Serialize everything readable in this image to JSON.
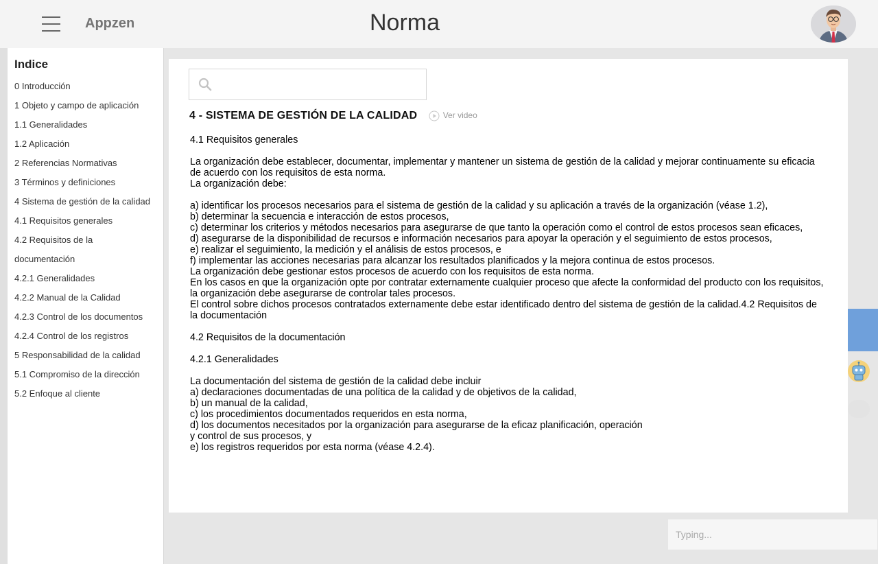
{
  "header": {
    "brand": "Appzen",
    "title": "Norma"
  },
  "sidebar": {
    "heading": "Indice",
    "items": [
      "0 Introducción",
      "1 Objeto y campo de aplicación",
      "1.1 Generalidades",
      "1.2 Aplicación",
      "2 Referencias Normativas",
      "3 Términos y definiciones",
      "4 Sistema de gestión de la calidad",
      "4.1 Requisitos generales",
      "4.2 Requisitos de la",
      "documentación",
      "4.2.1 Generalidades",
      "4.2.2 Manual de la Calidad",
      "4.2.3 Control de los documentos",
      "4.2.4 Control de los registros",
      "5 Responsabilidad de la calidad",
      "5.1 Compromiso de la dirección",
      "5.2 Enfoque al cliente"
    ]
  },
  "search": {
    "placeholder": ""
  },
  "section": {
    "title": "4 - SISTEMA DE GESTIÓN DE LA CALIDAD",
    "video_label": "Ver video"
  },
  "document": {
    "lines": [
      "4.1 Requisitos generales",
      "",
      "La organización debe establecer, documentar, implementar y mantener un sistema de gestión de la calidad y mejorar continuamente su eficacia de acuerdo con los requisitos de esta norma.",
      "La organización debe:",
      "",
      "a) identificar los procesos necesarios para el sistema de gestión de la calidad y su aplicación a través de la organización (véase 1.2),",
      "b) determinar la secuencia e interacción de estos procesos,",
      "c) determinar los criterios y métodos necesarios para asegurarse de que tanto la operación como el control de estos procesos sean eficaces,",
      "d) asegurarse de la disponibilidad de recursos e información necesarios para apoyar la operación y el seguimiento de estos procesos,",
      "e) realizar el seguimiento, la medición y el análisis de estos procesos, e",
      "f) implementar las acciones necesarias para alcanzar los resultados planificados y la mejora continua de estos procesos.",
      "La organización debe gestionar estos procesos de acuerdo con los requisitos de esta norma.",
      "En los casos en que la organización opte por contratar externamente cualquier proceso que afecte la conformidad del producto con los requisitos, la organización debe asegurarse de controlar tales procesos.",
      "El control sobre dichos procesos contratados externamente debe estar identificado dentro del sistema de gestión de la calidad.4.2 Requisitos de la documentación",
      "",
      "4.2 Requisitos de la documentación",
      "",
      "4.2.1 Generalidades",
      "",
      "La documentación del sistema de gestión de la calidad debe incluir",
      "a) declaraciones documentadas de una política de la calidad y de objetivos de la calidad,",
      "b) un manual de la calidad,",
      "c) los procedimientos documentados requeridos en esta norma,",
      "d) los documentos necesitados por la organización para asegurarse de la eficaz planificación, operación",
      "y control de sus procesos, y",
      "e) los registros requeridos por esta norma (véase 4.2.4)."
    ]
  },
  "chat": {
    "placeholder": "Typing..."
  },
  "colors": {
    "accent_blue": "#6fa0db",
    "header_bg": "#f4f4f4",
    "page_bg": "#e6e6e6"
  }
}
